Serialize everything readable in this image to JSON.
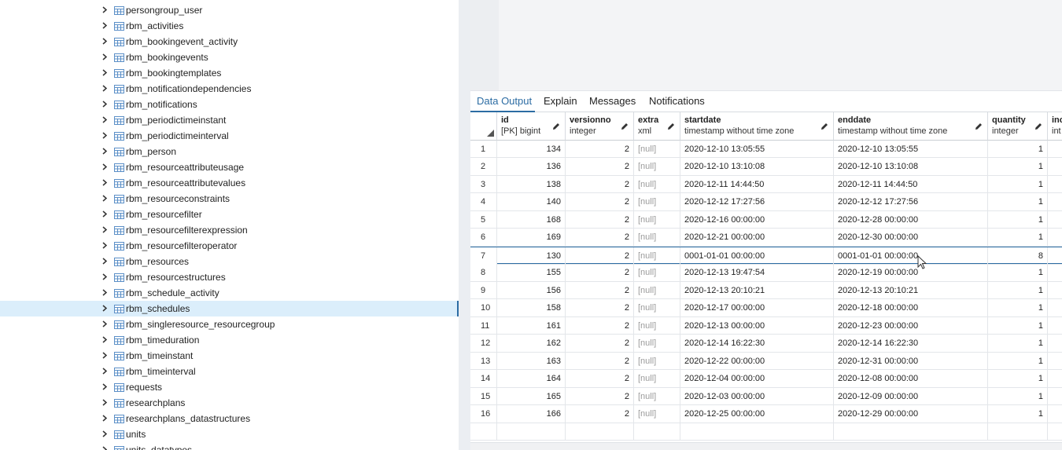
{
  "tree": {
    "items": [
      {
        "label": "persongroup_user"
      },
      {
        "label": "rbm_activities"
      },
      {
        "label": "rbm_bookingevent_activity"
      },
      {
        "label": "rbm_bookingevents"
      },
      {
        "label": "rbm_bookingtemplates"
      },
      {
        "label": "rbm_notificationdependencies"
      },
      {
        "label": "rbm_notifications"
      },
      {
        "label": "rbm_periodictimeinstant"
      },
      {
        "label": "rbm_periodictimeinterval"
      },
      {
        "label": "rbm_person"
      },
      {
        "label": "rbm_resourceattributeusage"
      },
      {
        "label": "rbm_resourceattributevalues"
      },
      {
        "label": "rbm_resourceconstraints"
      },
      {
        "label": "rbm_resourcefilter"
      },
      {
        "label": "rbm_resourcefilterexpression"
      },
      {
        "label": "rbm_resourcefilteroperator"
      },
      {
        "label": "rbm_resources"
      },
      {
        "label": "rbm_resourcestructures"
      },
      {
        "label": "rbm_schedule_activity"
      },
      {
        "label": "rbm_schedules",
        "selected": true
      },
      {
        "label": "rbm_singleresource_resourcegroup"
      },
      {
        "label": "rbm_timeduration"
      },
      {
        "label": "rbm_timeinstant"
      },
      {
        "label": "rbm_timeinterval"
      },
      {
        "label": "requests"
      },
      {
        "label": "researchplans"
      },
      {
        "label": "researchplans_datastructures"
      },
      {
        "label": "units"
      },
      {
        "label": "units_datatypes"
      }
    ]
  },
  "tabs": [
    {
      "label": "Data Output",
      "active": true
    },
    {
      "label": "Explain"
    },
    {
      "label": "Messages"
    },
    {
      "label": "Notifications"
    }
  ],
  "grid": {
    "columns": [
      {
        "name": "id",
        "type": "[PK] bigint"
      },
      {
        "name": "versionno",
        "type": "integer"
      },
      {
        "name": "extra",
        "type": "xml"
      },
      {
        "name": "startdate",
        "type": "timestamp without time zone"
      },
      {
        "name": "enddate",
        "type": "timestamp without time zone"
      },
      {
        "name": "quantity",
        "type": "integer"
      },
      {
        "name": "inc",
        "type": "int"
      }
    ],
    "rows": [
      {
        "n": "1",
        "id": "134",
        "v": "2",
        "x": "[null]",
        "s": "2020-12-10 13:05:55",
        "e": "2020-12-10 13:05:55",
        "q": "1"
      },
      {
        "n": "2",
        "id": "136",
        "v": "2",
        "x": "[null]",
        "s": "2020-12-10 13:10:08",
        "e": "2020-12-10 13:10:08",
        "q": "1"
      },
      {
        "n": "3",
        "id": "138",
        "v": "2",
        "x": "[null]",
        "s": "2020-12-11 14:44:50",
        "e": "2020-12-11 14:44:50",
        "q": "1"
      },
      {
        "n": "4",
        "id": "140",
        "v": "2",
        "x": "[null]",
        "s": "2020-12-12 17:27:56",
        "e": "2020-12-12 17:27:56",
        "q": "1"
      },
      {
        "n": "5",
        "id": "168",
        "v": "2",
        "x": "[null]",
        "s": "2020-12-16 00:00:00",
        "e": "2020-12-28 00:00:00",
        "q": "1"
      },
      {
        "n": "6",
        "id": "169",
        "v": "2",
        "x": "[null]",
        "s": "2020-12-21 00:00:00",
        "e": "2020-12-30 00:00:00",
        "q": "1"
      },
      {
        "n": "7",
        "id": "130",
        "v": "2",
        "x": "[null]",
        "s": "0001-01-01 00:00:00",
        "e": "0001-01-01 00:00:00",
        "q": "8",
        "selected": true
      },
      {
        "n": "8",
        "id": "155",
        "v": "2",
        "x": "[null]",
        "s": "2020-12-13 19:47:54",
        "e": "2020-12-19 00:00:00",
        "q": "1"
      },
      {
        "n": "9",
        "id": "156",
        "v": "2",
        "x": "[null]",
        "s": "2020-12-13 20:10:21",
        "e": "2020-12-13 20:10:21",
        "q": "1"
      },
      {
        "n": "10",
        "id": "158",
        "v": "2",
        "x": "[null]",
        "s": "2020-12-17 00:00:00",
        "e": "2020-12-18 00:00:00",
        "q": "1"
      },
      {
        "n": "11",
        "id": "161",
        "v": "2",
        "x": "[null]",
        "s": "2020-12-13 00:00:00",
        "e": "2020-12-23 00:00:00",
        "q": "1"
      },
      {
        "n": "12",
        "id": "162",
        "v": "2",
        "x": "[null]",
        "s": "2020-12-14 16:22:30",
        "e": "2020-12-14 16:22:30",
        "q": "1"
      },
      {
        "n": "13",
        "id": "163",
        "v": "2",
        "x": "[null]",
        "s": "2020-12-22 00:00:00",
        "e": "2020-12-31 00:00:00",
        "q": "1"
      },
      {
        "n": "14",
        "id": "164",
        "v": "2",
        "x": "[null]",
        "s": "2020-12-04 00:00:00",
        "e": "2020-12-08 00:00:00",
        "q": "1"
      },
      {
        "n": "15",
        "id": "165",
        "v": "2",
        "x": "[null]",
        "s": "2020-12-03 00:00:00",
        "e": "2020-12-09 00:00:00",
        "q": "1"
      },
      {
        "n": "16",
        "id": "166",
        "v": "2",
        "x": "[null]",
        "s": "2020-12-25 00:00:00",
        "e": "2020-12-29 00:00:00",
        "q": "1"
      }
    ]
  },
  "colors": {
    "accent": "#2c6ca3",
    "selected_bg": "#dbeefb",
    "null_text": "#9a9a9a"
  }
}
